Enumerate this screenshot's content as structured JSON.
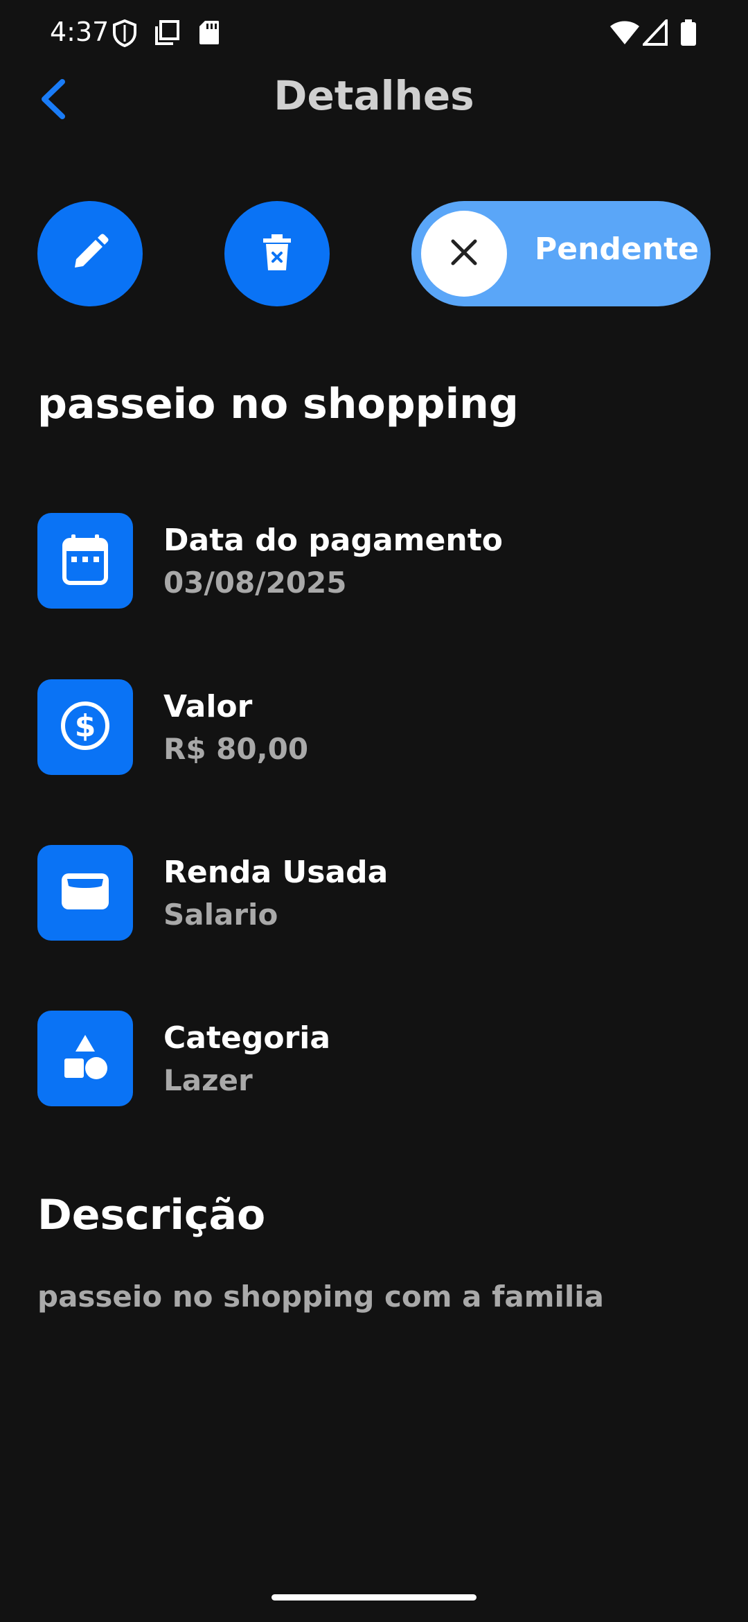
{
  "status_bar": {
    "time": "4:37",
    "icons": [
      "shield-icon",
      "copy-icon",
      "sd-card-icon",
      "wifi-icon",
      "signal-icon",
      "battery-icon"
    ]
  },
  "header": {
    "title": "Detalhes",
    "back_icon": "chevron-left-icon"
  },
  "actions": {
    "edit_icon": "pencil-icon",
    "delete_icon": "trash-icon",
    "status_toggle": {
      "label": "Pendente",
      "knob_icon": "close-icon"
    }
  },
  "transaction": {
    "title": "passeio no shopping"
  },
  "details": [
    {
      "label": "Data do pagamento",
      "value": "03/08/2025",
      "icon": "calendar-icon"
    },
    {
      "label": "Valor",
      "value": "R$ 80,00",
      "icon": "dollar-icon"
    },
    {
      "label": "Renda Usada",
      "value": "Salario",
      "icon": "wallet-icon"
    },
    {
      "label": "Categoria",
      "value": "Lazer",
      "icon": "shapes-icon"
    }
  ],
  "description": {
    "heading": "Descrição",
    "text": "passeio no shopping com a familia"
  },
  "colors": {
    "background": "#121212",
    "accent": "#0a73f5",
    "toggle_bg": "#5aa6f8",
    "muted_text": "#a9a9a9"
  }
}
